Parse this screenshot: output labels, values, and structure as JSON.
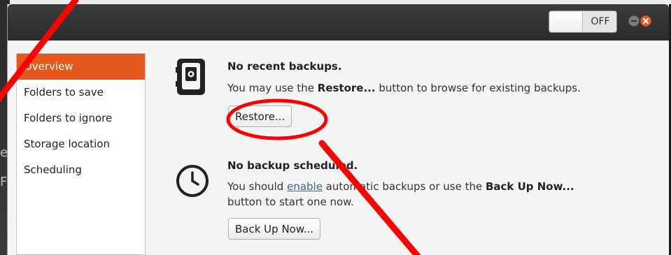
{
  "header": {
    "switch_label": "OFF"
  },
  "sidebar": {
    "items": [
      {
        "label": "Overview"
      },
      {
        "label": "Folders to save"
      },
      {
        "label": "Folders to ignore"
      },
      {
        "label": "Storage location"
      },
      {
        "label": "Scheduling"
      }
    ]
  },
  "restore_section": {
    "title": "No recent backups.",
    "desc_prefix": "You may use the ",
    "desc_bold": "Restore...",
    "desc_suffix": " button to browse for existing backups.",
    "button_label": "Restore..."
  },
  "schedule_section": {
    "title": "No backup scheduled.",
    "desc_prefix": "You should ",
    "desc_link": "enable",
    "desc_middle": " automatic backups or use the ",
    "desc_bold": "Back Up Now...",
    "desc_suffix": "button to start one now.",
    "button_label": "Back Up Now..."
  },
  "desktop": {
    "fragments": [
      "e",
      "F"
    ]
  },
  "colors": {
    "accent": "#e4571d",
    "annotation": "#ff0000",
    "link": "#2a6ab0"
  }
}
